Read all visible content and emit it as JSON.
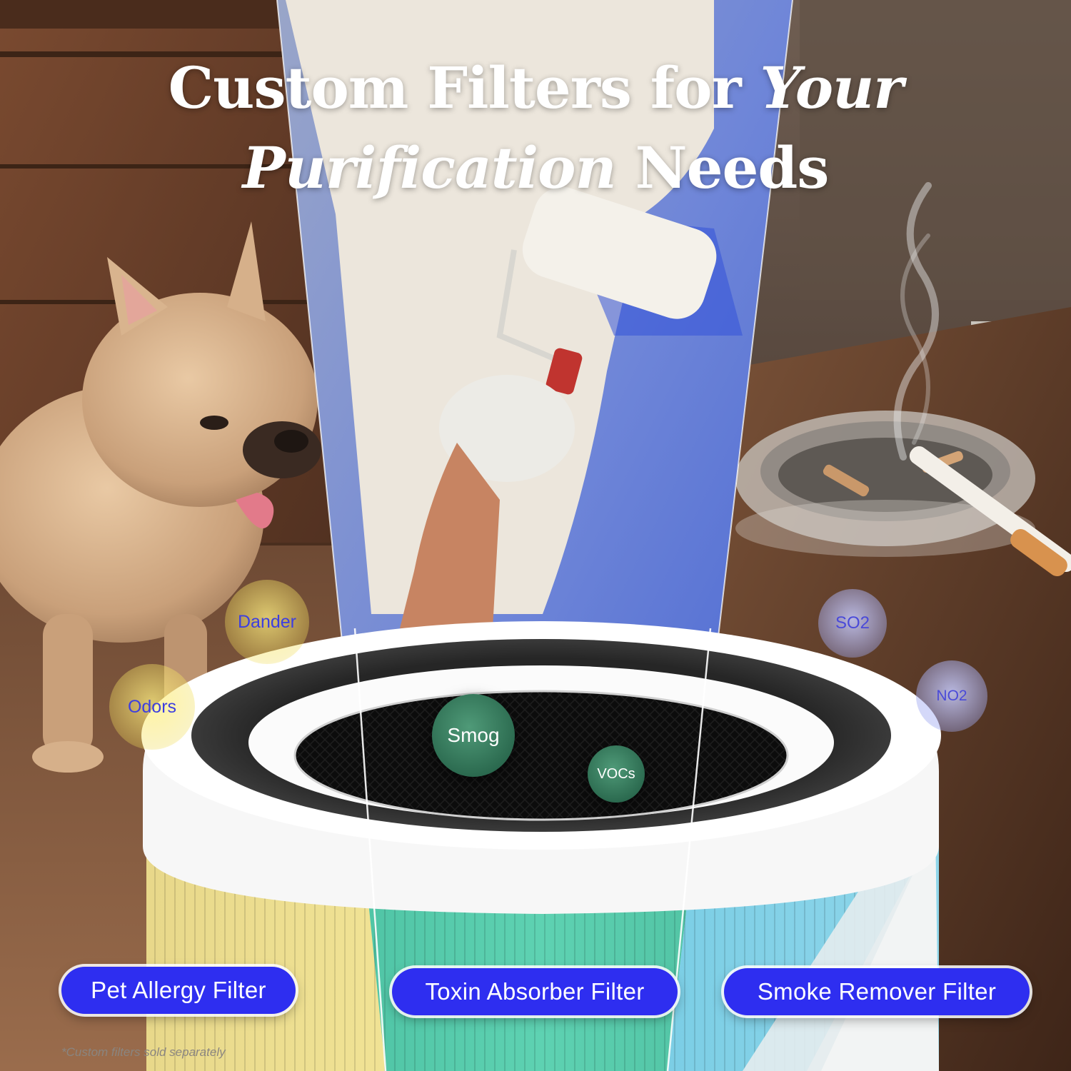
{
  "headline": {
    "line1_regular": "Custom Filters for ",
    "line1_italic": "Your",
    "line2_italic": "Purification",
    "line2_regular": " Needs"
  },
  "bubbles": {
    "dander": "Dander",
    "odors": "Odors",
    "smog": "Smog",
    "vocs": "VOCs",
    "so2": "SO2",
    "no2": "NO2"
  },
  "filters": {
    "pet": "Pet Allergy Filter",
    "toxin": "Toxin Absorber Filter",
    "smoke": "Smoke Remover Filter"
  },
  "footnote": "*Custom filters sold separately",
  "colors": {
    "pill": "#2e2ef0",
    "pet_filter": "#f3e49a",
    "toxin_filter": "#4fc9a8",
    "smoke_filter": "#5cc3de",
    "bubble_text": "#3d3ee0"
  }
}
